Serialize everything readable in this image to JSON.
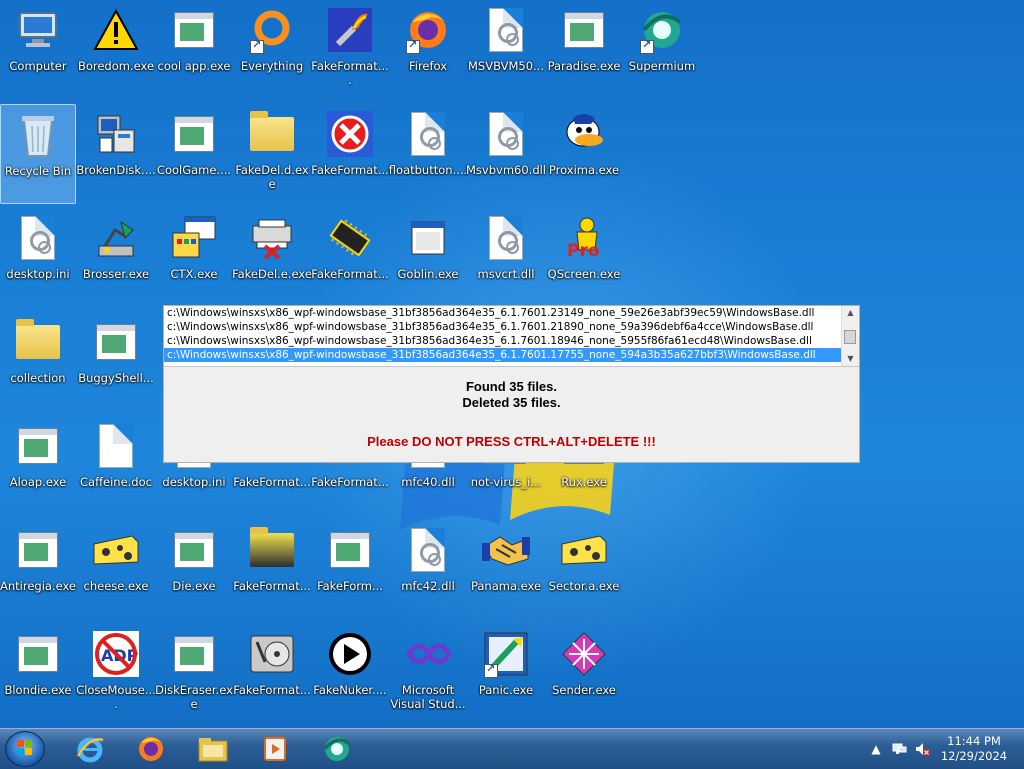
{
  "desktop_icons": [
    {
      "label": "Computer",
      "glyph": "computer-icon"
    },
    {
      "label": "Boredom.exe",
      "glyph": "warning-icon"
    },
    {
      "label": "cool app.exe",
      "glyph": "exe-icon"
    },
    {
      "label": "Everything",
      "glyph": "everything-icon"
    },
    {
      "label": "FakeFormat....",
      "glyph": "torch-icon"
    },
    {
      "label": "Firefox",
      "glyph": "firefox-icon"
    },
    {
      "label": "MSVBVM50...",
      "glyph": "dll-icon"
    },
    {
      "label": "Paradise.exe",
      "glyph": "exe-icon"
    },
    {
      "label": "Supermium",
      "glyph": "supermium-icon"
    },
    {
      "label": "Recycle Bin",
      "glyph": "recycle-bin-icon"
    },
    {
      "label": "BrokenDisk....",
      "glyph": "computer-setup-icon"
    },
    {
      "label": "CoolGame....",
      "glyph": "exe-icon"
    },
    {
      "label": "FakeDel.d.exe",
      "glyph": "folder-icon"
    },
    {
      "label": "FakeFormat...",
      "glyph": "red-x-icon"
    },
    {
      "label": "floatbutton....",
      "glyph": "dll-icon"
    },
    {
      "label": "Msvbvm60.dll",
      "glyph": "dll-icon"
    },
    {
      "label": "Proxima.exe",
      "glyph": "duck-icon"
    },
    {
      "label": "desktop.ini",
      "glyph": "ini-icon"
    },
    {
      "label": "Brosser.exe",
      "glyph": "lamp-icon"
    },
    {
      "label": "CTX.exe",
      "glyph": "ctx-icon"
    },
    {
      "label": "FakeDel.e.exe",
      "glyph": "printer-x-icon"
    },
    {
      "label": "FakeFormat...",
      "glyph": "chip-icon"
    },
    {
      "label": "Goblin.exe",
      "glyph": "window-icon"
    },
    {
      "label": "msvcrt.dll",
      "glyph": "dll-icon"
    },
    {
      "label": "QScreen.exe",
      "glyph": "qscreen-icon"
    },
    {
      "label": "collection",
      "glyph": "folder-icon"
    },
    {
      "label": "BuggyShell...",
      "glyph": "exe-icon"
    },
    {
      "label": "Aloap.exe",
      "glyph": "exe-icon"
    },
    {
      "label": "Caffeine.doc",
      "glyph": "doc-icon"
    },
    {
      "label": "desktop.ini",
      "glyph": "ini-icon"
    },
    {
      "label": "FakeFormat...",
      "glyph": "folder-icon"
    },
    {
      "label": "FakeFormat...",
      "glyph": "exe-icon"
    },
    {
      "label": "mfc40.dll",
      "glyph": "dll-icon"
    },
    {
      "label": "not-virus_i...",
      "glyph": "exe-icon"
    },
    {
      "label": "Rux.exe",
      "glyph": "exe-icon"
    },
    {
      "label": "Antiregia.exe",
      "glyph": "exe-icon"
    },
    {
      "label": "cheese.exe",
      "glyph": "cheese-icon"
    },
    {
      "label": "Die.exe",
      "glyph": "exe-icon"
    },
    {
      "label": "FakeFormat...",
      "glyph": "folder-dark-icon"
    },
    {
      "label": "FakeForm...",
      "glyph": "exe-icon"
    },
    {
      "label": "mfc42.dll",
      "glyph": "dll-icon"
    },
    {
      "label": "Panama.exe",
      "glyph": "handshake-icon"
    },
    {
      "label": "Sector.a.exe",
      "glyph": "cheese-icon"
    },
    {
      "label": "Blondie.exe",
      "glyph": "exe-icon"
    },
    {
      "label": "CloseMouse....",
      "glyph": "no-adp-icon"
    },
    {
      "label": "DiskEraser.exe",
      "glyph": "exe-icon"
    },
    {
      "label": "FakeFormat...",
      "glyph": "disk-icon"
    },
    {
      "label": "FakeNuker....",
      "glyph": "play-icon"
    },
    {
      "label": "Microsoft Visual Stud...",
      "glyph": "visual-studio-icon"
    },
    {
      "label": "Panic.exe",
      "glyph": "panic-icon"
    },
    {
      "label": "Sender.exe",
      "glyph": "sender-icon"
    }
  ],
  "dialog": {
    "list_items": [
      "c:\\Windows\\winsxs\\x86_wpf-windowsbase_31bf3856ad364e35_6.1.7601.23149_none_59e26e3abf39ec59\\WindowsBase.dll",
      "c:\\Windows\\winsxs\\x86_wpf-windowsbase_31bf3856ad364e35_6.1.7601.21890_none_59a396debf6a4cce\\WindowsBase.dll",
      "c:\\Windows\\winsxs\\x86_wpf-windowsbase_31bf3856ad364e35_6.1.7601.18946_none_5955f86fa61ecd48\\WindowsBase.dll",
      "c:\\Windows\\winsxs\\x86_wpf-windowsbase_31bf3856ad364e35_6.1.7601.17755_none_594a3b35a627bbf3\\WindowsBase.dll"
    ],
    "selected_index": 3,
    "found_text": "Found 35 files.",
    "deleted_text": "Deleted 35 files.",
    "warning_text": "Please DO NOT PRESS CTRL+ALT+DELETE !!!",
    "warning_color": "#c00000"
  },
  "taskbar": {
    "pinned": [
      "internet-explorer-icon",
      "firefox-icon",
      "file-explorer-icon",
      "media-player-icon",
      "supermium-icon"
    ],
    "tray": [
      "show-hidden-icons-icon",
      "network-icon",
      "volume-muted-icon"
    ],
    "clock_time": "11:44 PM",
    "clock_date": "12/29/2024"
  }
}
